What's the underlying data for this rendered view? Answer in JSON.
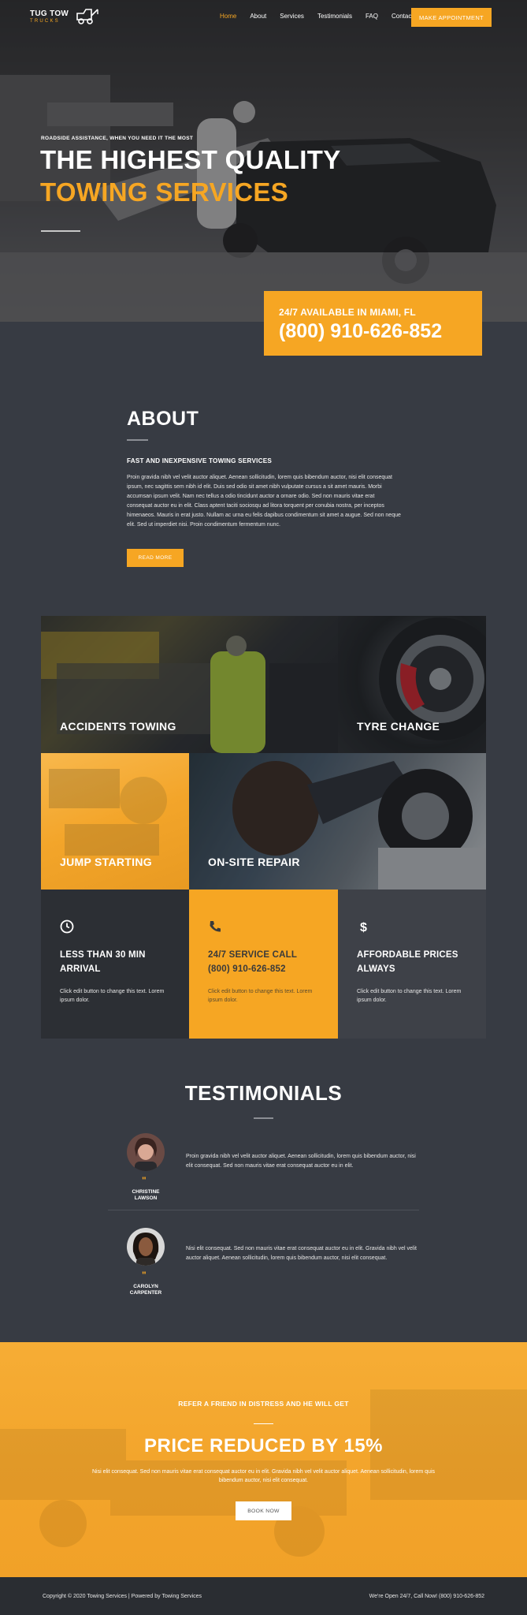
{
  "brand": {
    "line1": "TUG TOW",
    "line2": "TRUCKS"
  },
  "nav": {
    "links": [
      "Home",
      "About",
      "Services",
      "Testimonials",
      "FAQ",
      "Contact"
    ],
    "active": "Home",
    "cta": "MAKE APPOINTMENT"
  },
  "hero": {
    "kicker": "ROADSIDE ASSISTANCE, WHEN YOU NEED IT THE MOST",
    "title_line1": "THE HIGHEST QUALITY",
    "title_line2": "TOWING SERVICES",
    "call_label": "24/7 AVAILABLE IN MIAMI, FL",
    "call_number": "(800) 910-626-852"
  },
  "about": {
    "title": "ABOUT",
    "subtitle": "FAST AND INEXPENSIVE TOWING SERVICES",
    "body": "Proin gravida nibh vel velit auctor aliquet. Aenean sollicitudin, lorem quis bibendum auctor, nisi elit consequat ipsum, nec sagittis sem nibh id elit.  Duis sed odio sit amet nibh vulputate cursus a sit amet mauris.  Morbi accumsan ipsum velit.  Nam nec tellus a odio tincidunt auctor a ornare odio. Sed non mauris vitae erat consequat auctor eu in elit. Class aptent taciti sociosqu ad litora torquent per conubia nostra, per inceptos himenaeos.  Mauris in erat justo.  Nullam ac urna eu felis dapibus condimentum sit amet a augue. Sed non neque elit. Sed ut imperdiet nisi.  Proin condimentum fermentum nunc.",
    "button": "READ MORE"
  },
  "services": {
    "accidents": "ACCIDENTS TOWING",
    "tyre": "TYRE CHANGE",
    "jump": "JUMP STARTING",
    "repair": "ON-SITE REPAIR"
  },
  "features": [
    {
      "icon": "clock-icon",
      "title1": "LESS THAN 30 MIN",
      "title2": "ARRIVAL",
      "text": "Click edit button to change this text. Lorem ipsum dolor."
    },
    {
      "icon": "phone-icon",
      "title1": "24/7 SERVICE CALL",
      "title2": "(800) 910-626-852",
      "text": "Click edit button to change this text. Lorem ipsum dolor."
    },
    {
      "icon": "dollar-icon",
      "title1": "AFFORDABLE PRICES",
      "title2": "ALWAYS",
      "text": "Click edit button to change this text. Lorem ipsum dolor."
    }
  ],
  "testimonials": {
    "title": "TESTIMONIALS",
    "items": [
      {
        "name1": "CHRISTINE",
        "name2": "LAWSON",
        "text": "Proin gravida nibh vel velit auctor aliquet. Aenean sollicitudin, lorem quis bibendum auctor, nisi elit consequat. Sed non  mauris vitae erat consequat auctor eu in elit."
      },
      {
        "name1": "CAROLYN",
        "name2": "CARPENTER",
        "text": "Nisi elit consequat. Sed non  mauris vitae erat consequat auctor eu in elit. Gravida nibh vel velit auctor aliquet. Aenean sollicitudin, lorem quis bibendum auctor, nisi elit consequat."
      }
    ]
  },
  "promo": {
    "kicker": "REFER A FRIEND IN DISTRESS AND HE WILL GET",
    "title": "PRICE REDUCED BY 15%",
    "text": "Nisi elit consequat. Sed non mauris vitae erat consequat auctor eu in elit. Gravida nibh vel velit auctor aliquet. Aenean sollicitudin, lorem quis bibendum auctor, nisi elit consequat.",
    "button": "BOOK NOW"
  },
  "footer": {
    "left": "Copyright © 2020 Towing Services  |  Powered by Towing Services",
    "right": "We're Open 24/7, Call  Now! (800) 910-626-852"
  },
  "colors": {
    "accent": "#f6a623",
    "background": "#373b43",
    "footer": "#2a2d32"
  }
}
